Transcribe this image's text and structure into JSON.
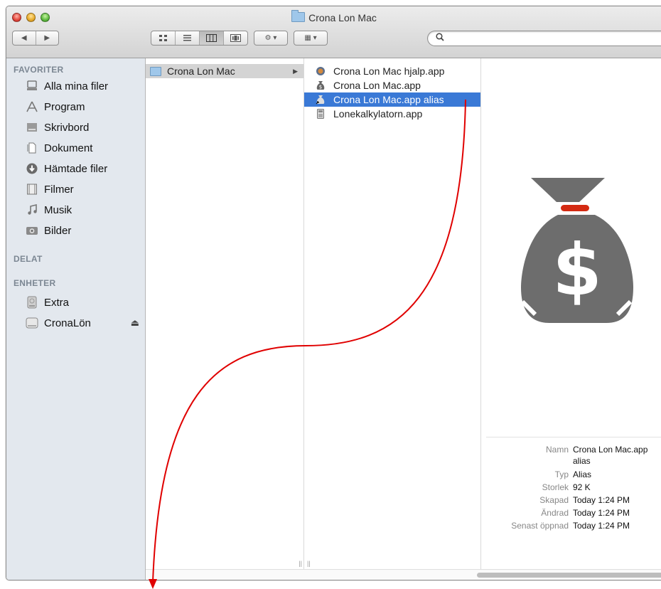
{
  "window": {
    "title": "Crona Lon Mac"
  },
  "toolbar": {
    "nav": {
      "back": "◀",
      "forward": "▶"
    },
    "views": [
      "icon-view",
      "list-view",
      "column-view",
      "coverflow-view"
    ],
    "action": "⚙ ▾",
    "arrange": "▦ ▾",
    "search_placeholder": ""
  },
  "sidebar": {
    "favorites_header": "FAVORITER",
    "favorites": [
      {
        "label": "Alla mina filer",
        "icon": "all-files-icon"
      },
      {
        "label": "Program",
        "icon": "applications-icon"
      },
      {
        "label": "Skrivbord",
        "icon": "desktop-icon"
      },
      {
        "label": "Dokument",
        "icon": "documents-icon"
      },
      {
        "label": "Hämtade filer",
        "icon": "downloads-icon"
      },
      {
        "label": "Filmer",
        "icon": "movies-icon"
      },
      {
        "label": "Musik",
        "icon": "music-icon"
      },
      {
        "label": "Bilder",
        "icon": "pictures-icon"
      }
    ],
    "shared_header": "DELAT",
    "devices_header": "ENHETER",
    "devices": [
      {
        "label": "Extra",
        "icon": "hard-drive-icon"
      },
      {
        "label": "CronaLön",
        "icon": "disk-image-icon",
        "eject": "⏏"
      }
    ]
  },
  "column1": {
    "items": [
      {
        "label": "Crona Lon Mac",
        "arrow": "▶"
      }
    ]
  },
  "column2": {
    "items": [
      {
        "label": "Crona Lon Mac hjalp.app"
      },
      {
        "label": "Crona Lon Mac.app"
      },
      {
        "label": "Crona Lon Mac.app alias"
      },
      {
        "label": "Lonekalkylatorn.app"
      }
    ]
  },
  "preview": {
    "icon": "money-bag-icon",
    "info": [
      {
        "key": "Namn",
        "value": "Crona Lon Mac.app",
        "value2": "alias"
      },
      {
        "key": "Typ",
        "value": "Alias"
      },
      {
        "key": "Storlek",
        "value": "92 K"
      },
      {
        "key": "Skapad",
        "value": "Today 1:24 PM"
      },
      {
        "key": "Ändrad",
        "value": "Today 1:24 PM"
      },
      {
        "key": "Senast öppnad",
        "value": "Today 1:24 PM"
      }
    ]
  },
  "colors": {
    "selection": "#3a79d6",
    "arrow": "#e00000",
    "bag": "#6d6d6d",
    "bag_tie": "#d42a12"
  }
}
